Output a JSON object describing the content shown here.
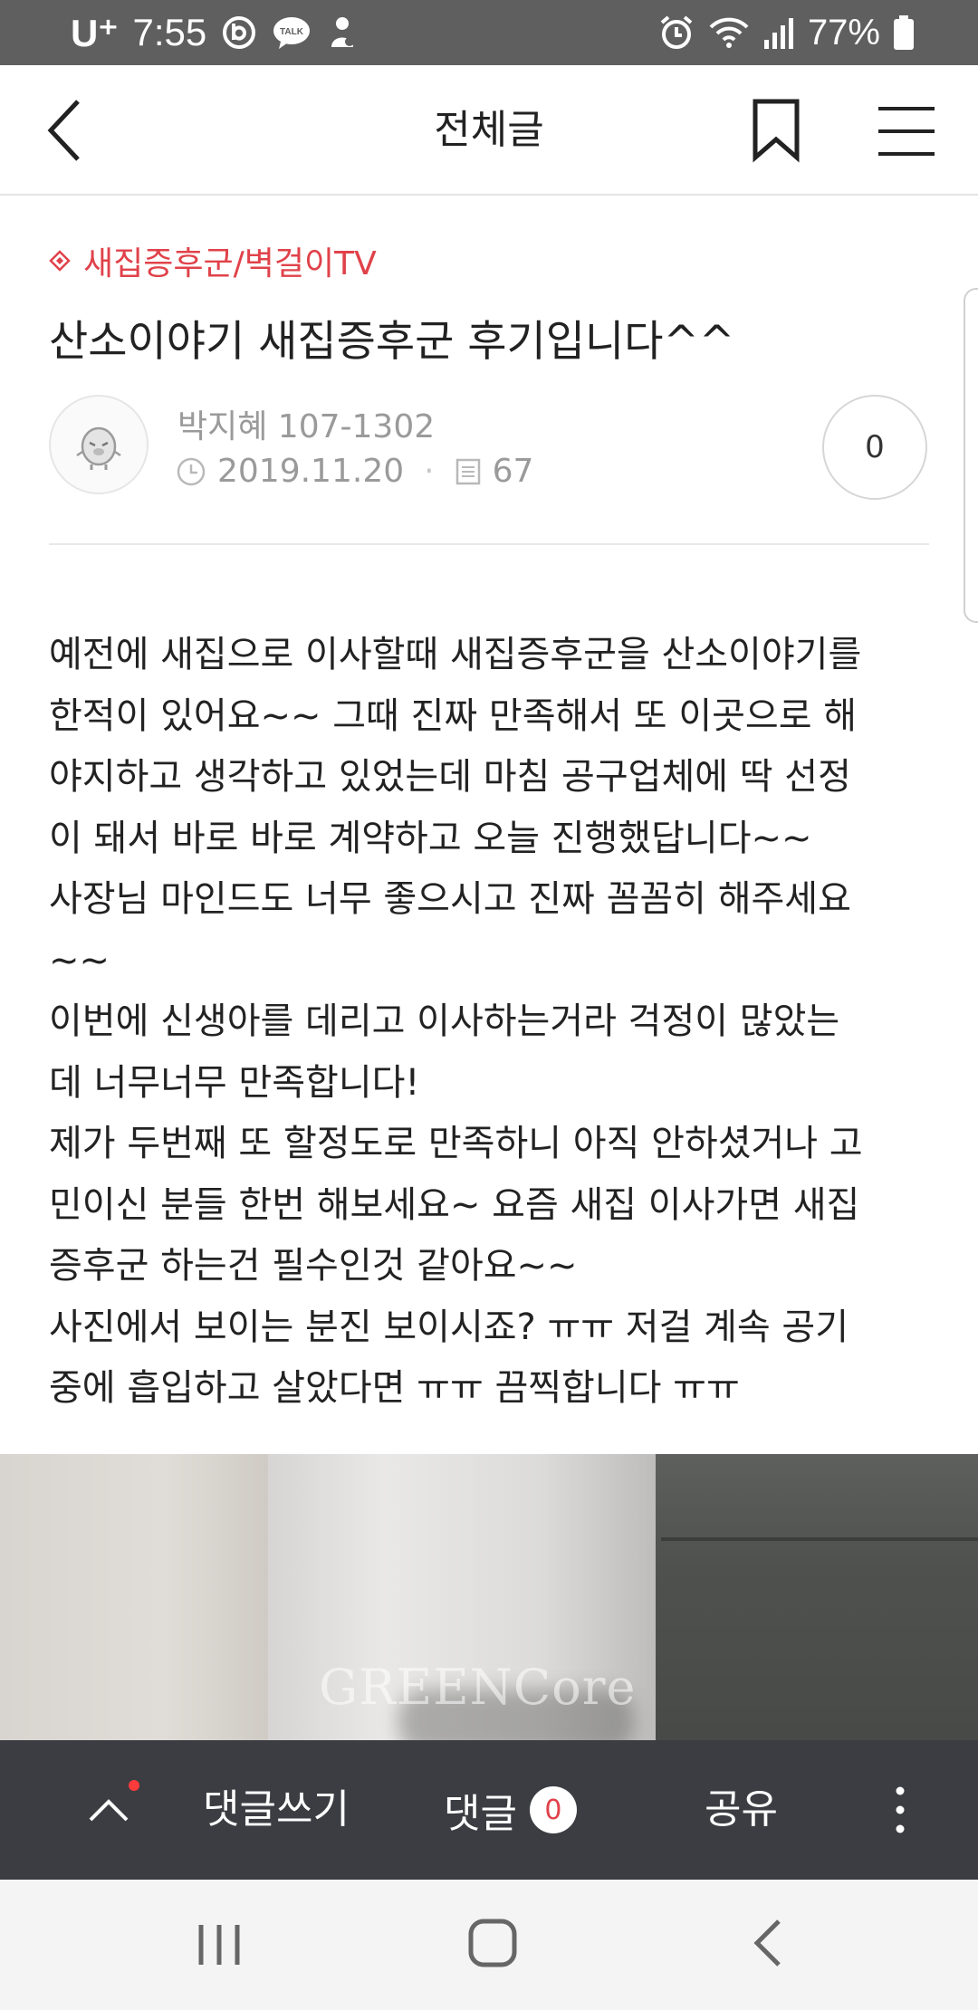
{
  "status_bar": {
    "carrier": "U⁺",
    "time": "7:55",
    "left_icons": [
      "band-icon",
      "kakaotalk-icon",
      "notification-icon"
    ],
    "right_icons": [
      "alarm-icon",
      "wifi-icon",
      "signal-icon"
    ],
    "battery_percent": "77%"
  },
  "app_bar": {
    "title": "전체글",
    "back_icon": "chevron-left-icon",
    "bookmark_icon": "bookmark-icon",
    "menu_icon": "hamburger-menu-icon"
  },
  "post": {
    "category": "새집증후군/벽걸이TV",
    "category_icon": "diamond-icon",
    "title": "산소이야기 새집증후군 후기입니다^^",
    "author": "박지혜 107-1302",
    "date": "2019.11.20",
    "views": "67",
    "like_count": "0",
    "body_lines": [
      "예전에 새집으로 이사할때 새집증후군을 산소이야기를",
      "한적이 있어요~~ 그때 진짜 만족해서 또 이곳으로 해",
      "야지하고 생각하고 있었는데 마침 공구업체에 딱 선정",
      "이 돼서 바로 바로 계약하고 오늘 진행했답니다~~",
      "사장님 마인드도 너무 좋으시고 진짜 꼼꼼히 해주세요",
      "~~",
      "이번에 신생아를 데리고 이사하는거라 걱정이 많았는",
      "데 너무너무 만족합니다!",
      "제가 두번째 또 할정도로 만족하니 아직 안하셨거나 고",
      "민이신 분들 한번 해보세요~ 요즘 새집 이사가면 새집",
      "증후군 하는건 필수인것 같아요~~",
      "사진에서 보이는 분진 보이시죠? ㅠㅠ 저걸 계속 공기",
      "중에 흡입하고 살았다면 ㅠㅠ 끔찍합니다 ㅠㅠ"
    ],
    "photo_watermark": "GREENCore"
  },
  "action_bar": {
    "write_comment": "댓글쓰기",
    "comments": "댓글",
    "comment_count": "0",
    "share": "공유"
  },
  "colors": {
    "status_bar": "#5f5f5f",
    "accent": "#e0424a",
    "action_bar": "#3b3d42",
    "nav_bar": "#f4f4f4"
  }
}
